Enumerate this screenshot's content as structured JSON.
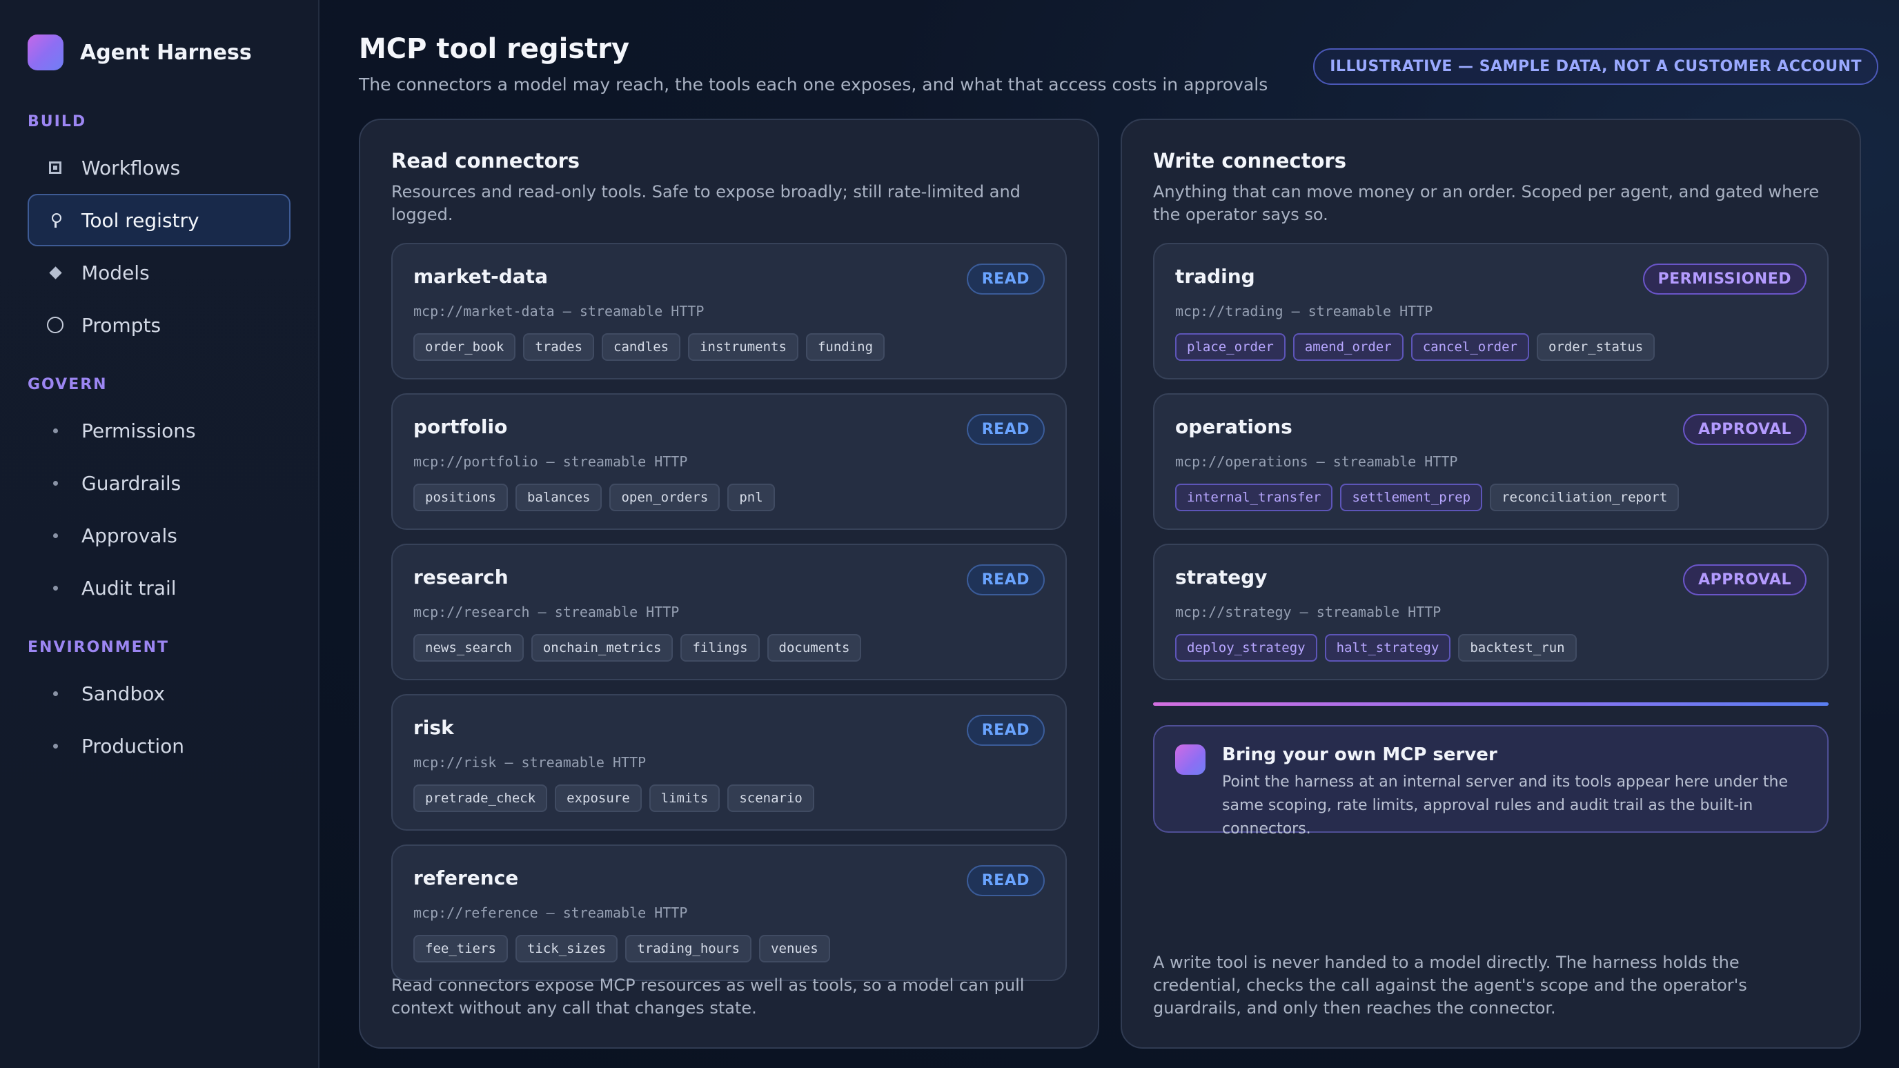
{
  "sidebar": {
    "brand": "Agent Harness",
    "sections": [
      {
        "heading": "BUILD",
        "items": [
          "Workflows",
          "Tool registry",
          "Models",
          "Prompts"
        ]
      },
      {
        "heading": "GOVERN",
        "items": [
          "Permissions",
          "Guardrails",
          "Approvals",
          "Audit trail"
        ]
      },
      {
        "heading": "ENVIRONMENT",
        "items": [
          "Sandbox",
          "Production"
        ]
      }
    ],
    "active_item": "Tool registry"
  },
  "header": {
    "title": "MCP tool registry",
    "subtitle": "The connectors a model may reach, the tools each one exposes, and what that access costs in approvals",
    "badge": "ILLUSTRATIVE — SAMPLE DATA, NOT A CUSTOMER ACCOUNT"
  },
  "read_panel": {
    "title": "Read connectors",
    "description": "Resources and read-only tools. Safe to expose broadly; still rate-limited and logged.",
    "connectors": [
      {
        "name": "market-data",
        "uri": "mcp://market-data — streamable HTTP",
        "badge": "READ",
        "tools": [
          "order_book",
          "trades",
          "candles",
          "instruments",
          "funding"
        ]
      },
      {
        "name": "portfolio",
        "uri": "mcp://portfolio — streamable HTTP",
        "badge": "READ",
        "tools": [
          "positions",
          "balances",
          "open_orders",
          "pnl"
        ]
      },
      {
        "name": "research",
        "uri": "mcp://research — streamable HTTP",
        "badge": "READ",
        "tools": [
          "news_search",
          "onchain_metrics",
          "filings",
          "documents"
        ]
      },
      {
        "name": "risk",
        "uri": "mcp://risk — streamable HTTP",
        "badge": "READ",
        "tools": [
          "pretrade_check",
          "exposure",
          "limits",
          "scenario"
        ]
      },
      {
        "name": "reference",
        "uri": "mcp://reference — streamable HTTP",
        "badge": "READ",
        "tools": [
          "fee_tiers",
          "tick_sizes",
          "trading_hours",
          "venues"
        ]
      }
    ],
    "footer": "Read connectors expose MCP resources as well as tools, so a model can pull context without any call that changes state."
  },
  "write_panel": {
    "title": "Write connectors",
    "description": "Anything that can move money or an order. Scoped per agent, and gated where the operator says so.",
    "connectors": [
      {
        "name": "trading",
        "uri": "mcp://trading — streamable HTTP",
        "badge": "PERMISSIONED",
        "tools": [
          {
            "name": "place_order",
            "write": true
          },
          {
            "name": "amend_order",
            "write": true
          },
          {
            "name": "cancel_order",
            "write": true
          },
          {
            "name": "order_status",
            "write": false
          }
        ]
      },
      {
        "name": "operations",
        "uri": "mcp://operations — streamable HTTP",
        "badge": "APPROVAL",
        "tools": [
          {
            "name": "internal_transfer",
            "write": true
          },
          {
            "name": "settlement_prep",
            "write": true
          },
          {
            "name": "reconciliation_report",
            "write": false
          }
        ]
      },
      {
        "name": "strategy",
        "uri": "mcp://strategy — streamable HTTP",
        "badge": "APPROVAL",
        "tools": [
          {
            "name": "deploy_strategy",
            "write": true
          },
          {
            "name": "halt_strategy",
            "write": true
          },
          {
            "name": "backtest_run",
            "write": false
          }
        ]
      }
    ],
    "byo": {
      "title": "Bring your own MCP server",
      "description": "Point the harness at an internal server and its tools appear here under the same scoping, rate limits, approval rules and audit trail as the built-in connectors."
    },
    "footer": "A write tool is never handed to a model directly. The harness holds the credential, checks the call against the agent's scope and the operator's guardrails, and only then reaches the connector."
  },
  "icons": {
    "Workflows": "square-icon",
    "Tool registry": "pin-icon",
    "Models": "diamond-icon",
    "Prompts": "circle-icon"
  },
  "colors": {
    "accent": "#9c86f2",
    "read_badge": "#6aa4ff",
    "write_badge": "#b49bff"
  }
}
